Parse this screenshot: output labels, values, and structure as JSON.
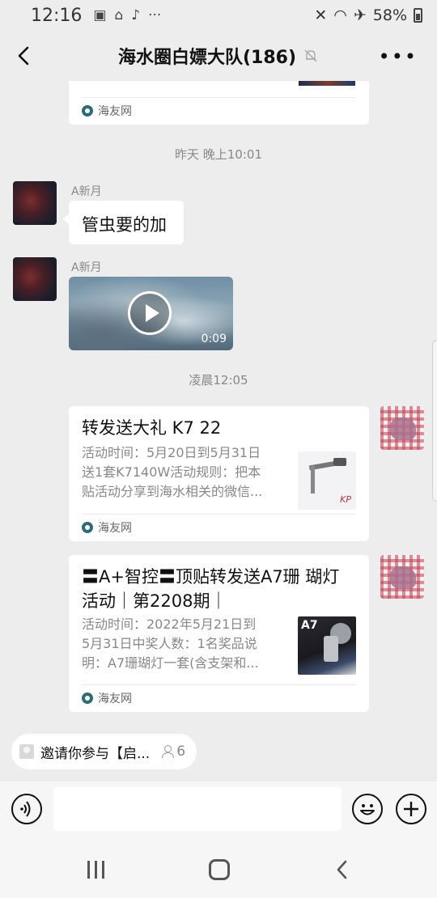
{
  "status_bar": {
    "time": "12:16",
    "left_icons": [
      "image-icon",
      "share-icon",
      "tiktok-icon",
      "more-dots-icon"
    ],
    "more_dots": "···",
    "battery": "58%",
    "right_icons": [
      "mute-icon",
      "wifi-icon",
      "airplane-icon",
      "battery-icon"
    ]
  },
  "header": {
    "title": "海水圈白嫖大队(186)",
    "more": "•••",
    "colors": {
      "background": "#ededed"
    }
  },
  "chat": {
    "top_card": {
      "source": "海友网"
    },
    "timestamp_1": "昨天 晚上10:01",
    "msg1": {
      "sender": "A新月",
      "text": "管虫要的加"
    },
    "msg2": {
      "sender": "A新月",
      "video_duration": "0:09"
    },
    "timestamp_2": "凌晨12:05",
    "card1": {
      "title": "转发送大礼 K7 22",
      "desc": "活动时间：5月20日到5月31日送1套K7140W活动规则：把本贴活动分享到海水相关的微信...",
      "desc_lines": [
        "活动时间：5月20日到5月31日",
        "送1套K7140W活动规则：把本",
        "贴活动分享到海水相关的微信..."
      ],
      "source": "海友网"
    },
    "card2": {
      "title_lines": [
        "〓A+智控〓顶贴转发送A7珊 瑚灯",
        "活动｜第2208期｜"
      ],
      "desc_lines": [
        "活动时间：2022年5月21日到",
        "5月31日中奖人数：1名奖品说",
        "明：A7珊瑚灯一套(含支架和..."
      ],
      "thumb_label": "A7",
      "source": "海友网"
    }
  },
  "group_notice": {
    "text": "邀请你参与【启...",
    "count": "6"
  },
  "input_bar": {
    "placeholder": ""
  }
}
